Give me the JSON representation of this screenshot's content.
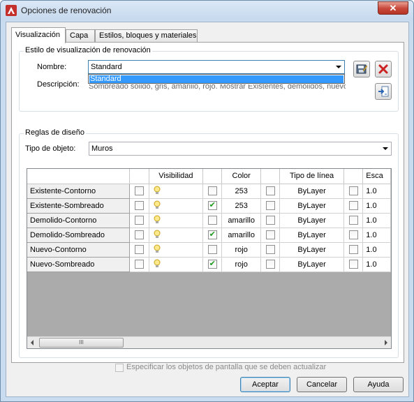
{
  "window": {
    "title": "Opciones de renovación",
    "close_glyph": "✕"
  },
  "tabs": [
    {
      "label": "Visualización",
      "active": true
    },
    {
      "label": "Capa",
      "active": false
    },
    {
      "label": "Estilos, bloques y materiales",
      "active": false
    }
  ],
  "display_style": {
    "group_label": "Estilo de visualización de renovación",
    "name_label": "Nombre:",
    "name_value": "Standard",
    "dropdown_options": [
      "Standard"
    ],
    "description_label": "Descripción:",
    "description_value": "Sombreado sólido, gris, amarillo, rojo. Mostrar Existentes, demolidos, nuevos",
    "buttons": {
      "save_icon": "save-icon",
      "delete_icon": "delete-icon",
      "import_icon": "import-icon"
    }
  },
  "design_rules": {
    "group_label": "Reglas de diseño",
    "object_type_label": "Tipo de objeto:",
    "object_type_value": "Muros",
    "columns": [
      "",
      "Visibilidad",
      "",
      "Color",
      "",
      "Tipo de línea",
      "",
      "Esca"
    ],
    "rows": [
      {
        "name": "Existente-Contorno",
        "visibility": true,
        "color_checked": false,
        "color": "253",
        "linetype_checked": false,
        "linetype": "ByLayer",
        "scale_checked": false,
        "scale": "1.0"
      },
      {
        "name": "Existente-Sombreado",
        "visibility": true,
        "color_checked": true,
        "color": "253",
        "linetype_checked": false,
        "linetype": "ByLayer",
        "scale_checked": false,
        "scale": "1.0"
      },
      {
        "name": "Demolido-Contorno",
        "visibility": true,
        "color_checked": false,
        "color": "amarillo",
        "linetype_checked": false,
        "linetype": "ByLayer",
        "scale_checked": false,
        "scale": "1.0"
      },
      {
        "name": "Demolido-Sombreado",
        "visibility": true,
        "color_checked": true,
        "color": "amarillo",
        "linetype_checked": false,
        "linetype": "ByLayer",
        "scale_checked": false,
        "scale": "1.0"
      },
      {
        "name": "Nuevo-Contorno",
        "visibility": true,
        "color_checked": false,
        "color": "rojo",
        "linetype_checked": false,
        "linetype": "ByLayer",
        "scale_checked": false,
        "scale": "1.0"
      },
      {
        "name": "Nuevo-Sombreado",
        "visibility": true,
        "color_checked": true,
        "color": "rojo",
        "linetype_checked": false,
        "linetype": "ByLayer",
        "scale_checked": false,
        "scale": "1.0"
      }
    ],
    "scroll_thumb_grip": "III"
  },
  "update_screen_option": {
    "label": "Especificar los objetos de pantalla que se deben actualizar",
    "checked": false,
    "enabled": false
  },
  "footer": {
    "accept_label": "Aceptar",
    "cancel_label": "Cancelar",
    "help_label": "Ayuda"
  },
  "colors": {
    "accent": "#3399ff",
    "title_bg": "#c9dbef",
    "check_green": "#1d9b1d",
    "delete_red": "#cc2222"
  }
}
